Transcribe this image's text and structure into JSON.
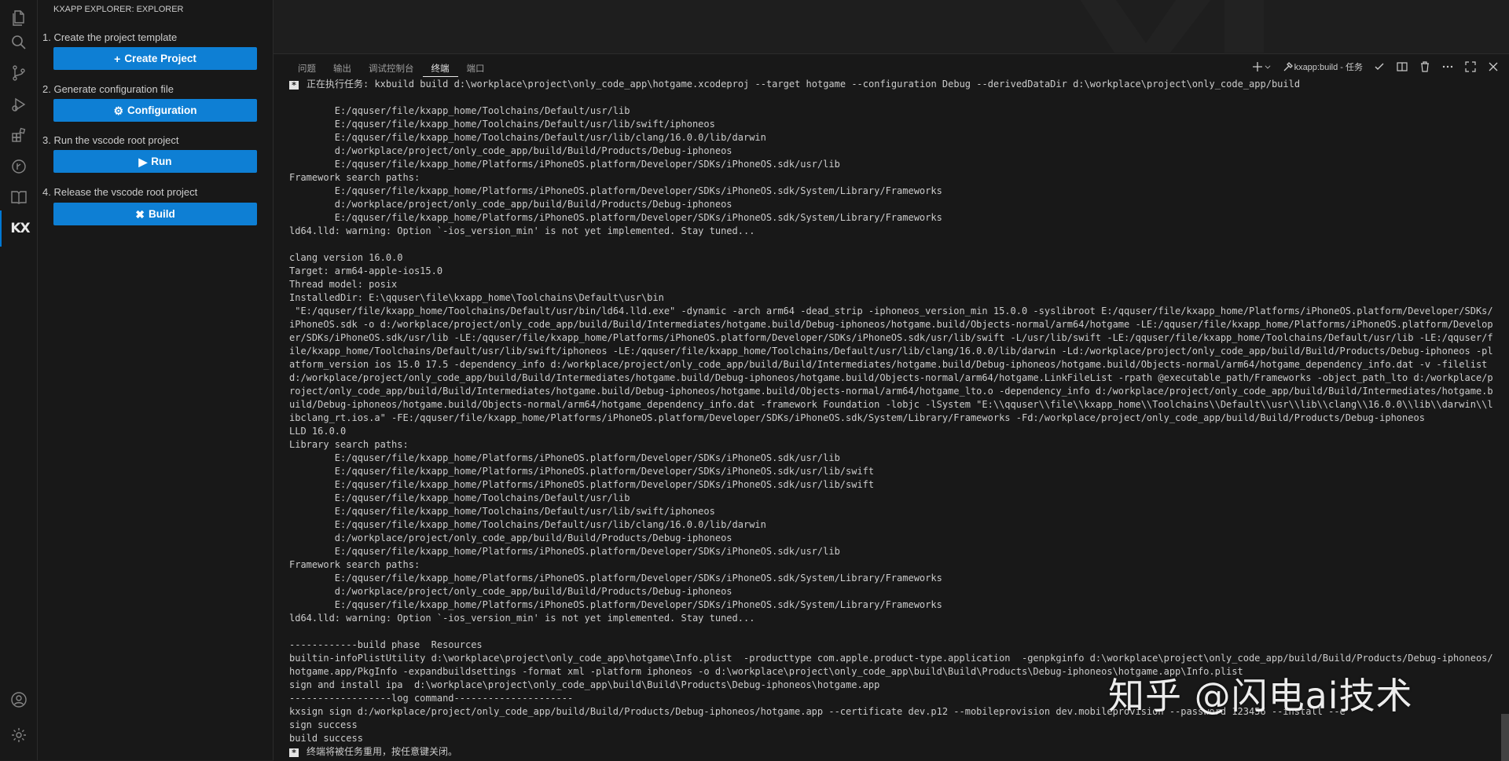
{
  "activity_bar": {
    "icons": [
      "files-icon",
      "search-icon",
      "source-control-icon",
      "run-debug-icon",
      "extensions-icon",
      "git-history-icon",
      "book-icon"
    ],
    "kx_label": "KX",
    "bottom_icons": [
      "account-icon",
      "settings-gear-icon"
    ]
  },
  "sidebar": {
    "title": "KXAPP EXPLORER: EXPLORER",
    "steps": [
      {
        "label": "1. Create the project template",
        "button": "Create Project",
        "icon": "plus-icon"
      },
      {
        "label": "2. Generate configuration file",
        "button": "Configuration",
        "icon": "gear-icon"
      },
      {
        "label": "3. Run the vscode root project",
        "button": "Run",
        "icon": "play-icon"
      },
      {
        "label": "4. Release the vscode root project",
        "button": "Build",
        "icon": "tools-icon"
      }
    ]
  },
  "panel": {
    "tabs": [
      "问题",
      "输出",
      "调试控制台",
      "终端",
      "端口"
    ],
    "active_tab": "终端",
    "terminal_name": "kxapp:build - 任务"
  },
  "terminal": {
    "lines": [
      {
        "mark": "*",
        "text": "正在执行任务: kxbuild build d:\\workplace\\project\\only_code_app\\hotgame.xcodeproj --target hotgame --configuration Debug --derivedDataDir d:\\workplace\\project\\only_code_app/build"
      },
      {
        "text": ""
      },
      {
        "text": "        E:/qquser/file/kxapp_home/Toolchains/Default/usr/lib"
      },
      {
        "text": "        E:/qquser/file/kxapp_home/Toolchains/Default/usr/lib/swift/iphoneos"
      },
      {
        "text": "        E:/qquser/file/kxapp_home/Toolchains/Default/usr/lib/clang/16.0.0/lib/darwin"
      },
      {
        "text": "        d:/workplace/project/only_code_app/build/Build/Products/Debug-iphoneos"
      },
      {
        "text": "        E:/qquser/file/kxapp_home/Platforms/iPhoneOS.platform/Developer/SDKs/iPhoneOS.sdk/usr/lib"
      },
      {
        "text": "Framework search paths:"
      },
      {
        "text": "        E:/qquser/file/kxapp_home/Platforms/iPhoneOS.platform/Developer/SDKs/iPhoneOS.sdk/System/Library/Frameworks"
      },
      {
        "text": "        d:/workplace/project/only_code_app/build/Build/Products/Debug-iphoneos"
      },
      {
        "text": "        E:/qquser/file/kxapp_home/Platforms/iPhoneOS.platform/Developer/SDKs/iPhoneOS.sdk/System/Library/Frameworks"
      },
      {
        "text": "ld64.lld: warning: Option `-ios_version_min' is not yet implemented. Stay tuned..."
      },
      {
        "text": ""
      },
      {
        "text": "clang version 16.0.0"
      },
      {
        "text": "Target: arm64-apple-ios15.0"
      },
      {
        "text": "Thread model: posix"
      },
      {
        "text": "InstalledDir: E:\\qquser\\file\\kxapp_home\\Toolchains\\Default\\usr\\bin"
      },
      {
        "text": " \"E:/qquser/file/kxapp_home/Toolchains/Default/usr/bin/ld64.lld.exe\" -dynamic -arch arm64 -dead_strip -iphoneos_version_min 15.0.0 -syslibroot E:/qquser/file/kxapp_home/Platforms/iPhoneOS.platform/Developer/SDKs/iPhoneOS.sdk -o d:/workplace/project/only_code_app/build/Build/Intermediates/hotgame.build/Debug-iphoneos/hotgame.build/Objects-normal/arm64/hotgame -LE:/qquser/file/kxapp_home/Platforms/iPhoneOS.platform/Developer/SDKs/iPhoneOS.sdk/usr/lib -LE:/qquser/file/kxapp_home/Platforms/iPhoneOS.platform/Developer/SDKs/iPhoneOS.sdk/usr/lib/swift -L/usr/lib/swift -LE:/qquser/file/kxapp_home/Toolchains/Default/usr/lib -LE:/qquser/file/kxapp_home/Toolchains/Default/usr/lib/swift/iphoneos -LE:/qquser/file/kxapp_home/Toolchains/Default/usr/lib/clang/16.0.0/lib/darwin -Ld:/workplace/project/only_code_app/build/Build/Products/Debug-iphoneos -platform_version ios 15.0 17.5 -dependency_info d:/workplace/project/only_code_app/build/Build/Intermediates/hotgame.build/Debug-iphoneos/hotgame.build/Objects-normal/arm64/hotgame_dependency_info.dat -v -filelist d:/workplace/project/only_code_app/build/Build/Intermediates/hotgame.build/Debug-iphoneos/hotgame.build/Objects-normal/arm64/hotgame.LinkFileList -rpath @executable_path/Frameworks -object_path_lto d:/workplace/project/only_code_app/build/Build/Intermediates/hotgame.build/Debug-iphoneos/hotgame.build/Objects-normal/arm64/hotgame_lto.o -dependency_info d:/workplace/project/only_code_app/build/Build/Intermediates/hotgame.build/Debug-iphoneos/hotgame.build/Objects-normal/arm64/hotgame_dependency_info.dat -framework Foundation -lobjc -lSystem \"E:\\\\qquser\\\\file\\\\kxapp_home\\\\Toolchains\\\\Default\\\\usr\\\\lib\\\\clang\\\\16.0.0\\\\lib\\\\darwin\\\\libclang_rt.ios.a\" -FE:/qquser/file/kxapp_home/Platforms/iPhoneOS.platform/Developer/SDKs/iPhoneOS.sdk/System/Library/Frameworks -Fd:/workplace/project/only_code_app/build/Build/Products/Debug-iphoneos"
      },
      {
        "text": "LLD 16.0.0"
      },
      {
        "text": "Library search paths:"
      },
      {
        "text": "        E:/qquser/file/kxapp_home/Platforms/iPhoneOS.platform/Developer/SDKs/iPhoneOS.sdk/usr/lib"
      },
      {
        "text": "        E:/qquser/file/kxapp_home/Platforms/iPhoneOS.platform/Developer/SDKs/iPhoneOS.sdk/usr/lib/swift"
      },
      {
        "text": "        E:/qquser/file/kxapp_home/Platforms/iPhoneOS.platform/Developer/SDKs/iPhoneOS.sdk/usr/lib/swift"
      },
      {
        "text": "        E:/qquser/file/kxapp_home/Toolchains/Default/usr/lib"
      },
      {
        "text": "        E:/qquser/file/kxapp_home/Toolchains/Default/usr/lib/swift/iphoneos"
      },
      {
        "text": "        E:/qquser/file/kxapp_home/Toolchains/Default/usr/lib/clang/16.0.0/lib/darwin"
      },
      {
        "text": "        d:/workplace/project/only_code_app/build/Build/Products/Debug-iphoneos"
      },
      {
        "text": "        E:/qquser/file/kxapp_home/Platforms/iPhoneOS.platform/Developer/SDKs/iPhoneOS.sdk/usr/lib"
      },
      {
        "text": "Framework search paths:"
      },
      {
        "text": "        E:/qquser/file/kxapp_home/Platforms/iPhoneOS.platform/Developer/SDKs/iPhoneOS.sdk/System/Library/Frameworks"
      },
      {
        "text": "        d:/workplace/project/only_code_app/build/Build/Products/Debug-iphoneos"
      },
      {
        "text": "        E:/qquser/file/kxapp_home/Platforms/iPhoneOS.platform/Developer/SDKs/iPhoneOS.sdk/System/Library/Frameworks"
      },
      {
        "text": "ld64.lld: warning: Option `-ios_version_min' is not yet implemented. Stay tuned..."
      },
      {
        "text": ""
      },
      {
        "text": "------------build phase  Resources"
      },
      {
        "text": "builtin-infoPlistUtility d:\\workplace\\project\\only_code_app\\hotgame\\Info.plist  -producttype com.apple.product-type.application  -genpkginfo d:\\workplace\\project\\only_code_app/build/Build/Products/Debug-iphoneos/hotgame.app/PkgInfo -expandbuildsettings -format xml -platform iphoneos -o d:\\workplace\\project\\only_code_app\\build\\Build\\Products\\Debug-iphoneos\\hotgame.app\\Info.plist"
      },
      {
        "text": "sign and install ipa  d:\\workplace\\project\\only_code_app\\build\\Build\\Products\\Debug-iphoneos\\hotgame.app"
      },
      {
        "text": "------------------log command---------------------"
      },
      {
        "text": "kxsign sign d:/workplace/project/only_code_app/build/Build/Products/Debug-iphoneos/hotgame.app --certificate dev.p12 --mobileprovision dev.mobileprovision --password 123456 --install --e"
      },
      {
        "text": "sign success"
      },
      {
        "text": "build success"
      },
      {
        "mark": "*",
        "text": "终端将被任务重用，按任意键关闭。"
      }
    ]
  },
  "watermark_text": "知乎 @闪电ai技术",
  "colors": {
    "accent_button": "#0e7fd4",
    "background": "#181818",
    "editor": "#1e1e1e"
  }
}
